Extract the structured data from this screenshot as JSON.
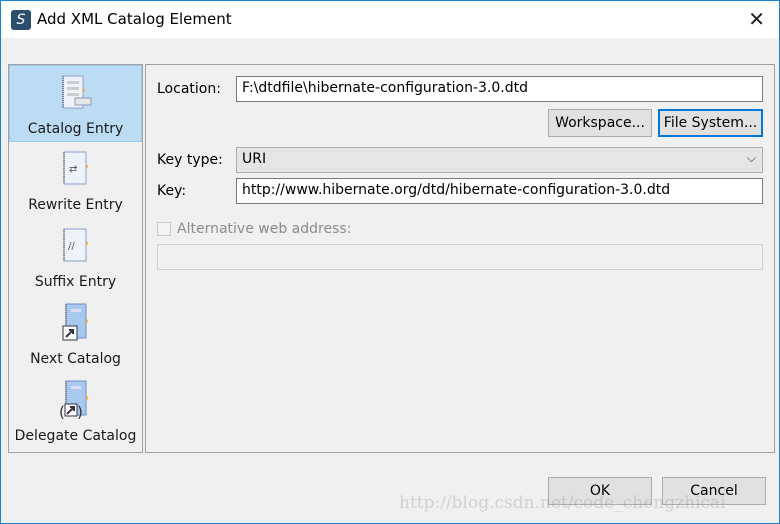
{
  "window": {
    "title": "Add XML Catalog Element"
  },
  "sidebar": {
    "items": [
      {
        "label": "Catalog Entry",
        "icon": "catalog-entry-icon",
        "selected": true
      },
      {
        "label": "Rewrite Entry",
        "icon": "rewrite-entry-icon"
      },
      {
        "label": "Suffix Entry",
        "icon": "suffix-entry-icon"
      },
      {
        "label": "Next Catalog",
        "icon": "next-catalog-icon"
      },
      {
        "label": "Delegate Catalog",
        "icon": "delegate-catalog-icon"
      }
    ]
  },
  "form": {
    "location_label": "Location:",
    "location_value": "F:\\dtdfile\\hibernate-configuration-3.0.dtd",
    "workspace_button": "Workspace...",
    "filesystem_button": "File System...",
    "key_type_label": "Key type:",
    "key_type_value": "URI",
    "key_label": "Key:",
    "key_value": "http://www.hibernate.org/dtd/hibernate-configuration-3.0.dtd",
    "alt_label": "Alternative web address:",
    "alt_value": ""
  },
  "footer": {
    "ok": "OK",
    "cancel": "Cancel",
    "watermark": "http://blog.csdn.net/code_chengzhicai"
  }
}
